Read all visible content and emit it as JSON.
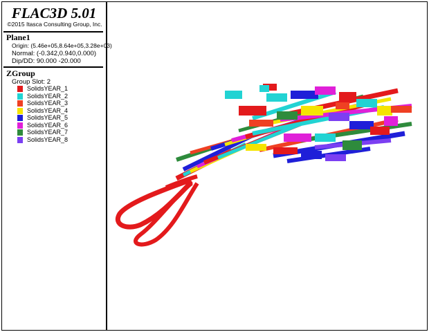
{
  "app": {
    "title": "FLAC3D 5.01",
    "copyright": "©2015 Itasca Consulting Group, Inc."
  },
  "plane": {
    "header": "Plane1",
    "origin": "Origin: (5.46e+05,8.64e+05,3.28e+03)",
    "normal": "Normal: (-0.342,0.940,0.000)",
    "dipdd": "Dip/DD: 90.000 -20.000"
  },
  "zgroup": {
    "header": "ZGroup",
    "slot": "Group Slot: 2",
    "items": [
      {
        "label": "SolidsYEAR_1",
        "color": "#e31a1c"
      },
      {
        "label": "SolidsYEAR_2",
        "color": "#22d3d3"
      },
      {
        "label": "SolidsYEAR_3",
        "color": "#ef4023"
      },
      {
        "label": "SolidsYEAR_4",
        "color": "#f5e400"
      },
      {
        "label": "SolidsYEAR_5",
        "color": "#1f1fd8"
      },
      {
        "label": "SolidsYEAR_6",
        "color": "#e020d8"
      },
      {
        "label": "SolidsYEAR_7",
        "color": "#2e8b3c"
      },
      {
        "label": "SolidsYEAR_8",
        "color": "#7b3ff2"
      }
    ]
  }
}
